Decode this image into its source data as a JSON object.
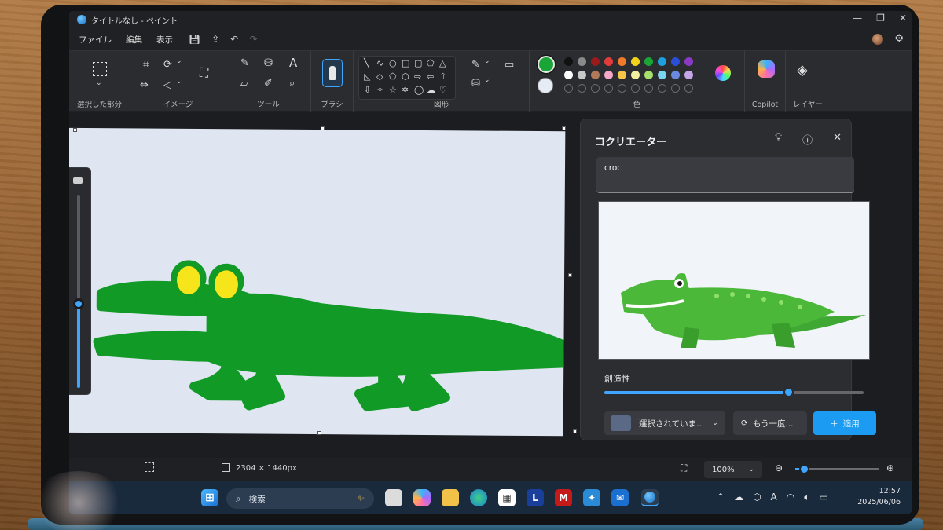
{
  "window": {
    "title": "タイトルなし - ペイント",
    "controls": [
      "—",
      "❐",
      "✕"
    ]
  },
  "menu": {
    "file": "ファイル",
    "edit": "編集",
    "view": "表示"
  },
  "ribbon": {
    "selection_label": "選択した部分",
    "image_label": "イメージ",
    "tools_label": "ツール",
    "brush_label": "ブラシ",
    "shapes_label": "図形",
    "color_label": "色",
    "copilot_label": "Copilot",
    "layers_label": "レイヤー",
    "current_color": "#1aa636",
    "palette_row1": [
      "#111111",
      "#8a8a8a",
      "#9b1b1b",
      "#e23b3b",
      "#f07a2a",
      "#f2d21a",
      "#1aa636",
      "#1e9fe0",
      "#2a4fd6",
      "#8a3ac2"
    ],
    "palette_row2": [
      "#ffffff",
      "#c8c8c8",
      "#b07a5a",
      "#f6a6c6",
      "#f6c64a",
      "#f0f0a0",
      "#a6e06a",
      "#7ad6f0",
      "#6a8ae0",
      "#c6a6e6"
    ]
  },
  "cocreator": {
    "title": "コクリエーター",
    "prompt": "croc",
    "creativity_label": "創造性",
    "creativity_value": 0.71,
    "select_button": "選択されていま...",
    "retry_button": "もう一度...",
    "apply_button": "適用"
  },
  "statusbar": {
    "dimensions": "2304 × 1440px",
    "zoom": "100%",
    "zoom_level": 0.1
  },
  "taskbar": {
    "search_placeholder": "検索",
    "time": "12:57",
    "date": "2025/06/06",
    "input_indicator": "A"
  }
}
